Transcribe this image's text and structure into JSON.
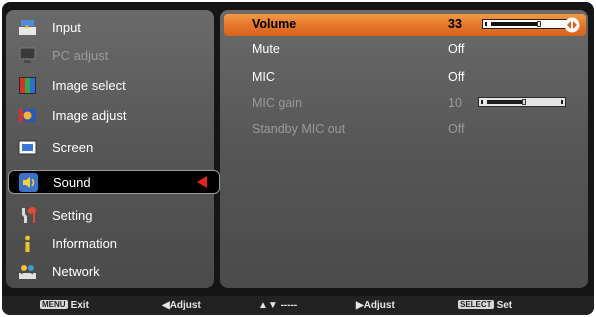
{
  "left_menu": [
    {
      "label": "Input",
      "icon": "input-icon",
      "disabled": false,
      "selected": false
    },
    {
      "label": "PC adjust",
      "icon": "pc-adjust-icon",
      "disabled": true,
      "selected": false
    },
    {
      "label": "Image select",
      "icon": "image-select-icon",
      "disabled": false,
      "selected": false
    },
    {
      "label": "Image adjust",
      "icon": "image-adjust-icon",
      "disabled": false,
      "selected": false
    },
    {
      "label": "Screen",
      "icon": "screen-icon",
      "disabled": false,
      "selected": false
    },
    {
      "label": "Sound",
      "icon": "sound-icon",
      "disabled": false,
      "selected": true
    },
    {
      "label": "Setting",
      "icon": "setting-icon",
      "disabled": false,
      "selected": false
    },
    {
      "label": "Information",
      "icon": "information-icon",
      "disabled": false,
      "selected": false
    },
    {
      "label": "Network",
      "icon": "network-icon",
      "disabled": false,
      "selected": false
    }
  ],
  "sound_menu": {
    "volume": {
      "label": "Volume",
      "value": "33",
      "level": 0.66
    },
    "mute": {
      "label": "Mute",
      "value": "Off"
    },
    "mic": {
      "label": "MIC",
      "value": "Off"
    },
    "mic_gain": {
      "label": "MIC gain",
      "value": "10",
      "level": 0.5
    },
    "standby_mic_out": {
      "label": "Standby MIC out",
      "value": "Off"
    }
  },
  "footer": {
    "exit_key": "MENU",
    "exit_label": "Exit",
    "adjust_left_label": "Adjust",
    "updown_label": "-----",
    "adjust_right_label": "Adjust",
    "select_key": "SELECT",
    "select_label": "Set"
  },
  "colors": {
    "highlight": "#e5762a",
    "panel": "#5c5c5c",
    "selected_arrow": "#e3261d"
  }
}
